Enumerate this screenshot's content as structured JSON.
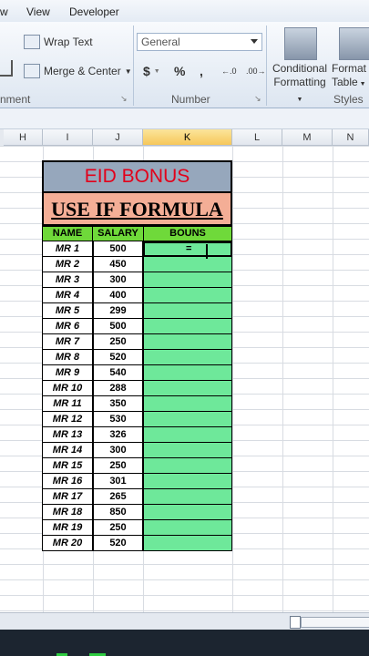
{
  "menu": {
    "items": [
      "w",
      "View",
      "Developer"
    ]
  },
  "ribbon": {
    "wrap_text": "Wrap Text",
    "merge_center": "Merge & Center",
    "number_format": "General",
    "currency": "$",
    "percent": "%",
    "comma": ",",
    "increase_decimal": "←.0",
    "decrease_decimal": ".00→",
    "conditional_formatting_1": "Conditional",
    "conditional_formatting_2": "Formatting",
    "format_table_1": "Format",
    "format_table_2": "Table",
    "groups": {
      "alignment": "nment",
      "number": "Number",
      "styles": "Styles"
    }
  },
  "columns": [
    "H",
    "I",
    "J",
    "K",
    "L",
    "M",
    "N"
  ],
  "selected_column": "K",
  "sheet": {
    "title": "EID BONUS",
    "subtitle": "USE IF FORMULA",
    "headers": {
      "name": "NAME",
      "salary": "SALARY",
      "bonus": "BOUNS"
    },
    "active_cell_entry": "=",
    "rows": [
      {
        "name": "MR 1",
        "salary": "500"
      },
      {
        "name": "MR 2",
        "salary": "450"
      },
      {
        "name": "MR 3",
        "salary": "300"
      },
      {
        "name": "MR 4",
        "salary": "400"
      },
      {
        "name": "MR 5",
        "salary": "299"
      },
      {
        "name": "MR 6",
        "salary": "500"
      },
      {
        "name": "MR 7",
        "salary": "250"
      },
      {
        "name": "MR 8",
        "salary": "520"
      },
      {
        "name": "MR 9",
        "salary": "540"
      },
      {
        "name": "MR 10",
        "salary": "288"
      },
      {
        "name": "MR 11",
        "salary": "350"
      },
      {
        "name": "MR 12",
        "salary": "530"
      },
      {
        "name": "MR 13",
        "salary": "326"
      },
      {
        "name": "MR 14",
        "salary": "300"
      },
      {
        "name": "MR 15",
        "salary": "250"
      },
      {
        "name": "MR 16",
        "salary": "301"
      },
      {
        "name": "MR 17",
        "salary": "265"
      },
      {
        "name": "MR 18",
        "salary": "850"
      },
      {
        "name": "MR 19",
        "salary": "250"
      },
      {
        "name": "MR 20",
        "salary": "520"
      }
    ]
  },
  "colors": {
    "title_bg": "#96a7bc",
    "title_text": "#e2001a",
    "subtitle_bg": "#f4ae96",
    "header_bg": "#6fd93a",
    "bonus_bg": "#6ee89a",
    "selected_col": "#f6c75a"
  }
}
